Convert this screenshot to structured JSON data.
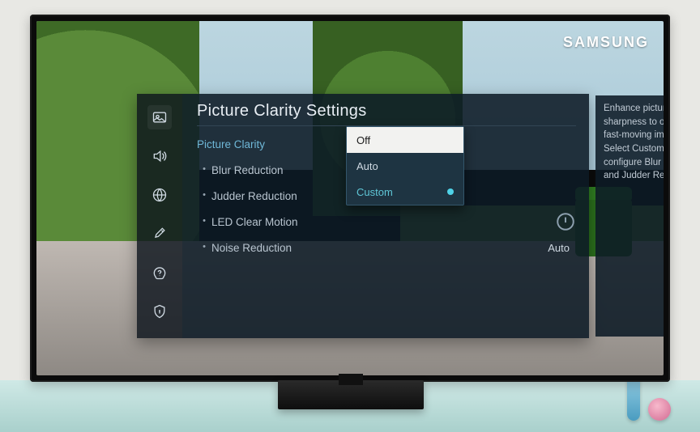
{
  "brand": "SAMSUNG",
  "menu": {
    "title": "Picture Clarity Settings",
    "help": "Enhance picture sharpness to optimize fast-moving images. Select Custom to configure Blur Reduction and Judder Reduction.",
    "sidebar_icons": [
      "picture-icon",
      "sound-icon",
      "network-icon",
      "settings-icon",
      "support-icon",
      "privacy-icon"
    ],
    "items": {
      "picture_clarity": {
        "label": "Picture Clarity",
        "value": "Off"
      },
      "blur_reduction": {
        "label": "Blur Reduction"
      },
      "judder_reduction": {
        "label": "Judder Reduction"
      },
      "led_clear_motion": {
        "label": "LED Clear Motion",
        "value": "off"
      },
      "noise_reduction": {
        "label": "Noise Reduction",
        "value": "Auto"
      }
    },
    "dropdown": {
      "options": [
        "Off",
        "Auto",
        "Custom"
      ],
      "selected": "Off",
      "marked": "Custom"
    }
  }
}
